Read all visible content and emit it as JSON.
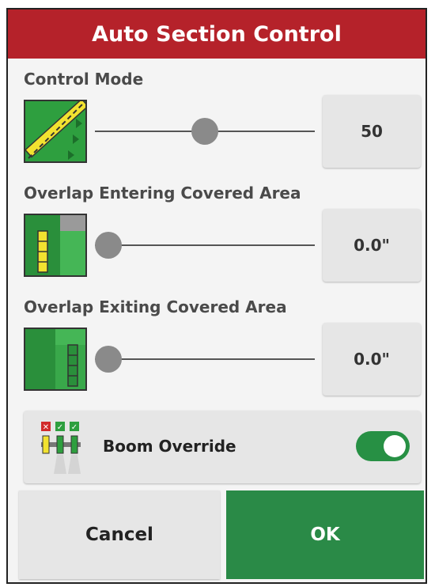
{
  "dialog": {
    "title": "Auto Section Control"
  },
  "control_mode": {
    "label": "Control Mode",
    "icon": "swath-line-icon",
    "slider_value": 50,
    "slider_min": 0,
    "slider_max": 100,
    "value_text": "50"
  },
  "overlap_entering": {
    "label": "Overlap Entering Covered Area",
    "icon": "overlap-entering-icon",
    "value_text": "0.0\"",
    "slider_fraction": 0.0
  },
  "overlap_exiting": {
    "label": "Overlap Exiting Covered Area",
    "icon": "overlap-exiting-icon",
    "value_text": "0.0\"",
    "slider_fraction": 0.0
  },
  "boom_override": {
    "label": "Boom Override",
    "icon": "boom-sections-icon",
    "enabled": true
  },
  "footer": {
    "cancel_label": "Cancel",
    "ok_label": "OK"
  },
  "colors": {
    "title_bar": "#b5222a",
    "ok_green": "#2a8a47",
    "toggle_on": "#279044",
    "button_gray": "#e6e6e6"
  }
}
